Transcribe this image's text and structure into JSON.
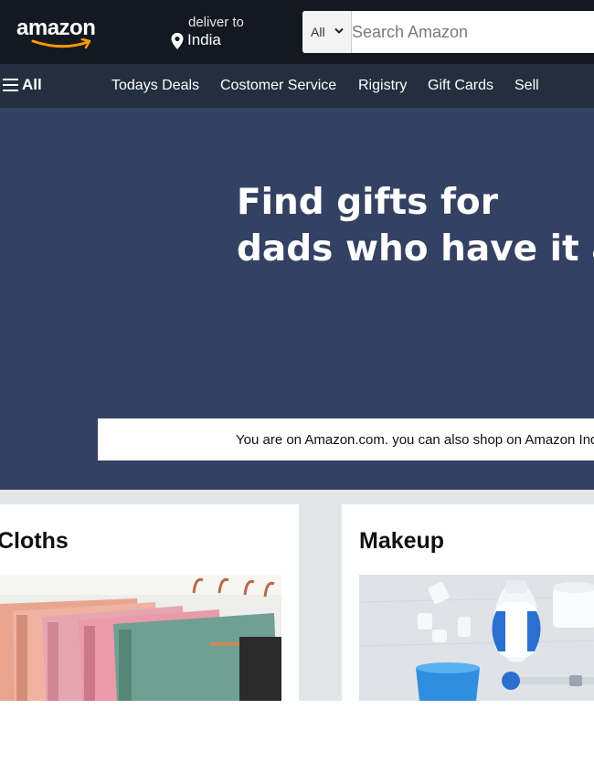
{
  "header": {
    "logo_text": "amazon",
    "deliver_label": "deliver to",
    "deliver_country": "India",
    "search": {
      "category": "All",
      "placeholder": "Search Amazon"
    }
  },
  "subnav": {
    "all_label": "All",
    "links": [
      "Todays Deals",
      "Costomer Service",
      "Rigistry",
      "Gift Cards",
      "Sell"
    ]
  },
  "hero": {
    "title_line1": "Find gifts for",
    "title_line2": "dads who have it all",
    "notice": "You are on Amazon.com. you can also shop on Amazon India"
  },
  "cards": [
    {
      "title": "Cloths",
      "image": "folded-clothes-on-hangers"
    },
    {
      "title": "Makeup",
      "image": "makeup-products"
    }
  ],
  "colors": {
    "topbar": "#131921",
    "subnav": "#232f3e",
    "hero": "#344163",
    "accent": "#ff9900",
    "cards_bg": "#e3e6e6"
  },
  "icons": [
    "map-pin-icon",
    "chevron-down-icon",
    "hamburger-menu-icon",
    "amazon-smile-icon"
  ]
}
